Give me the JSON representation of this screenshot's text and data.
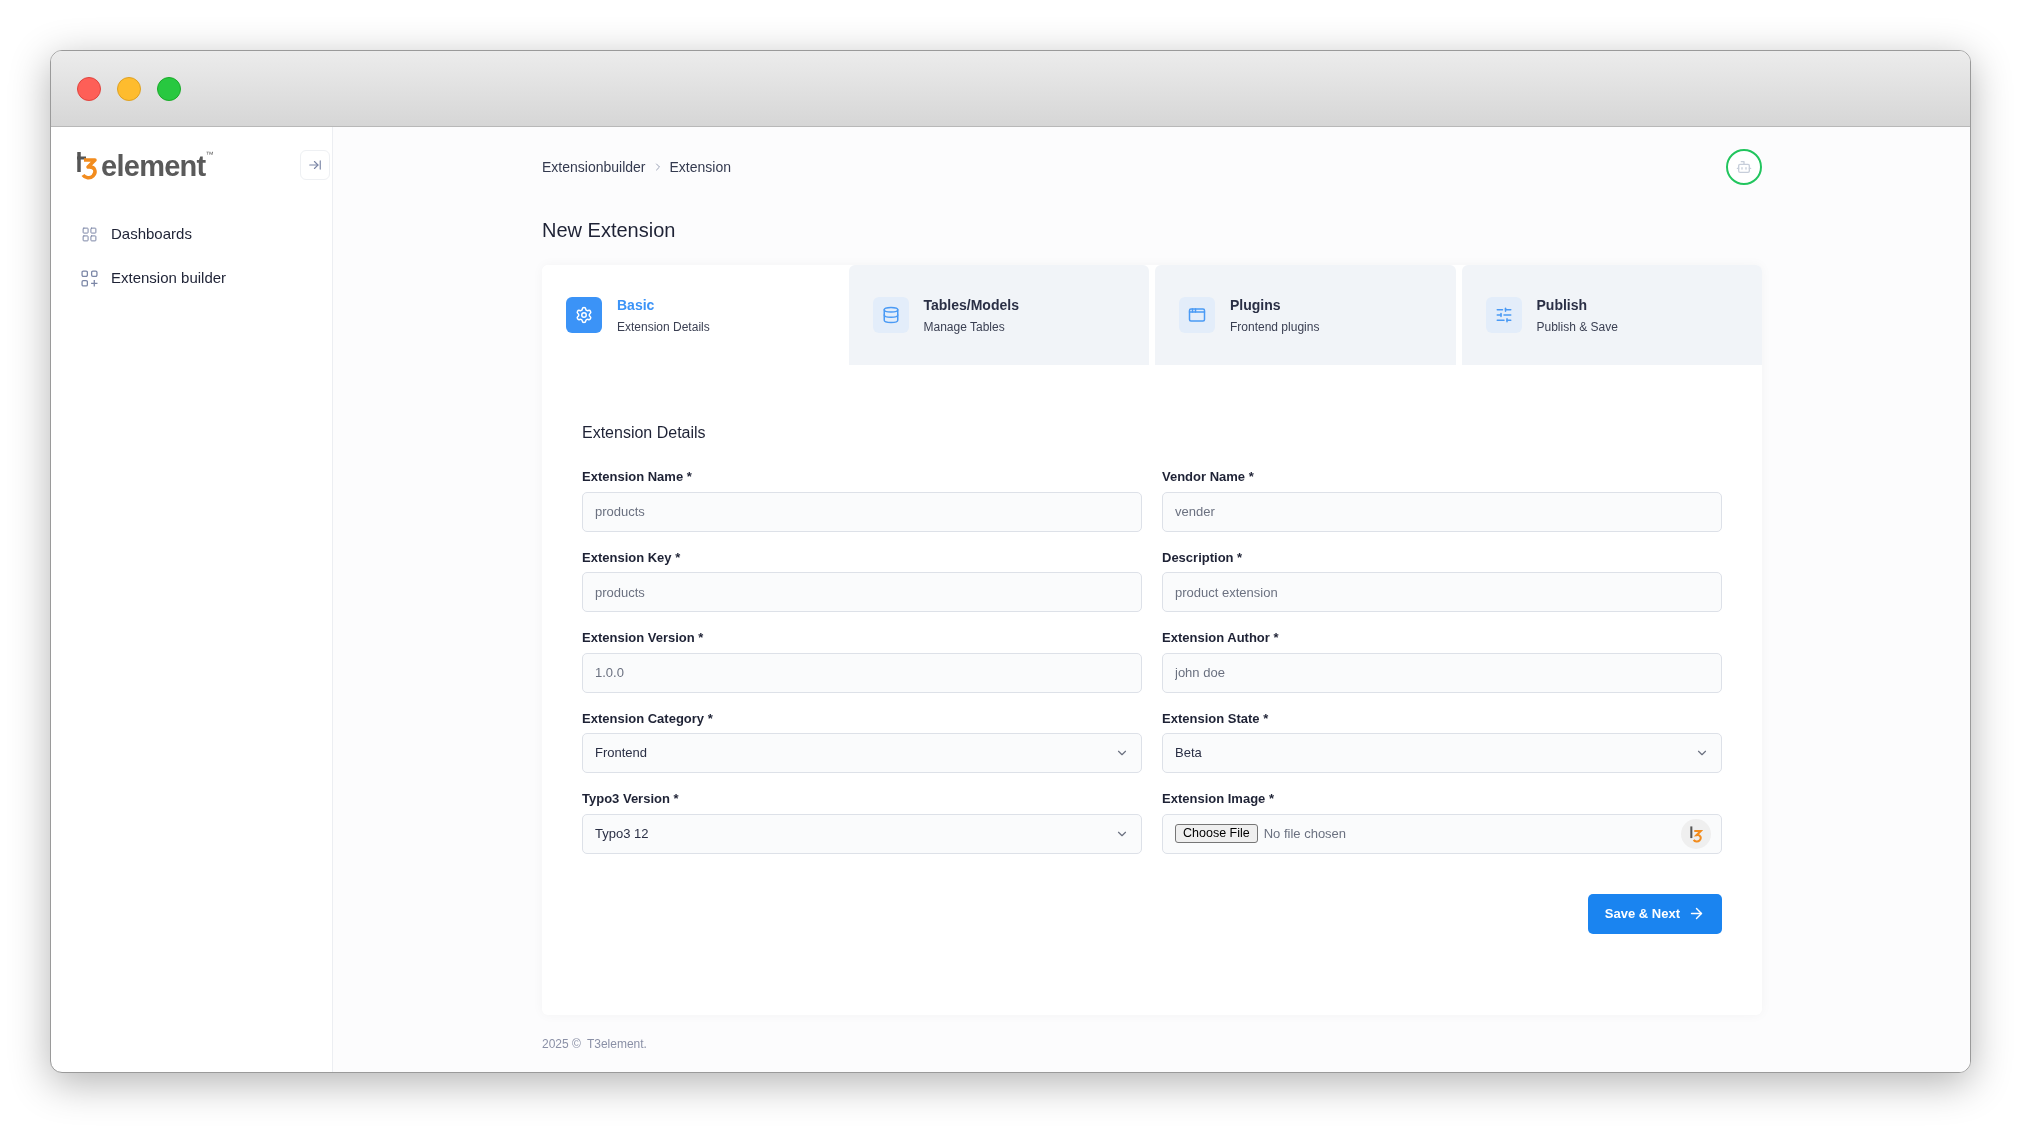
{
  "logo": {
    "wordmark": "element",
    "trademark": "™"
  },
  "sidebar": {
    "items": [
      {
        "label": "Dashboards",
        "selected": false
      },
      {
        "label": "Extension builder",
        "selected": false
      }
    ]
  },
  "breadcrumb": [
    "Extensionbuilder",
    "Extension"
  ],
  "page_title": "New Extension",
  "steps": [
    {
      "title": "Basic",
      "subtitle": "Extension Details",
      "selected": true
    },
    {
      "title": "Tables/Models",
      "subtitle": "Manage Tables",
      "selected": false
    },
    {
      "title": "Plugins",
      "subtitle": "Frontend plugins",
      "selected": false
    },
    {
      "title": "Publish",
      "subtitle": "Publish & Save",
      "selected": false
    }
  ],
  "section_title": "Extension Details",
  "fields": [
    {
      "label": "Extension Name *",
      "kind": "text",
      "placeholder": "products"
    },
    {
      "label": "Vendor Name *",
      "kind": "text",
      "placeholder": "vender"
    },
    {
      "label": "Extension Key *",
      "kind": "text",
      "placeholder": "products"
    },
    {
      "label": "Description *",
      "kind": "text",
      "placeholder": "product extension"
    },
    {
      "label": "Extension Version *",
      "kind": "text",
      "placeholder": "1.0.0"
    },
    {
      "label": "Extension Author *",
      "kind": "text",
      "placeholder": "john doe"
    },
    {
      "label": "Extension Category *",
      "kind": "select",
      "value": "Frontend"
    },
    {
      "label": "Extension State *",
      "kind": "select",
      "value": "Beta"
    },
    {
      "label": "Typo3 Version *",
      "kind": "select",
      "value": "Typo3 12"
    },
    {
      "label": "Extension Image *",
      "kind": "file",
      "button": "Choose File",
      "placeholder": "No file chosen"
    }
  ],
  "save_button": "Save & Next",
  "footer": {
    "year": "2025 ©",
    "brand": "T3element."
  }
}
